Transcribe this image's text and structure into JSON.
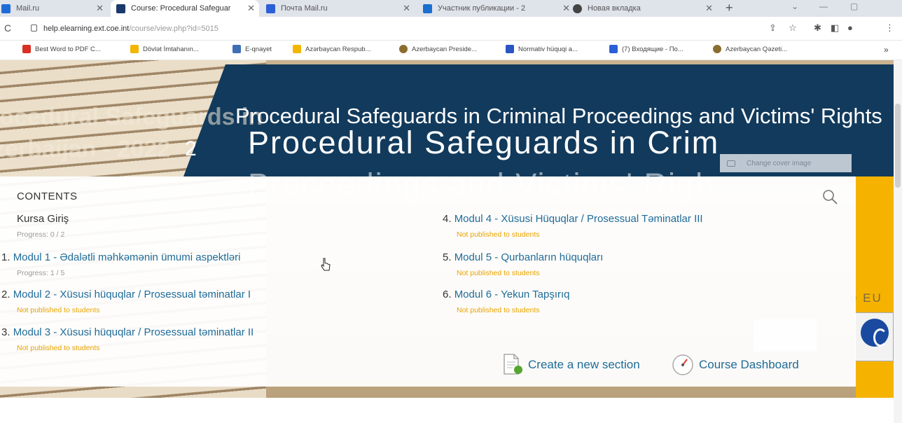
{
  "browser": {
    "tabs": [
      {
        "label": "Mail.ru",
        "color": "#1e6bd8",
        "active": false
      },
      {
        "label": "Course: Procedural Safeguar",
        "color": "#1a3a6c",
        "active": true
      },
      {
        "label": "Почта Mail.ru",
        "color": "#2b5fd8",
        "active": false
      },
      {
        "label": "Участник публикации - 2",
        "color": "#1a6fd0",
        "active": false
      },
      {
        "label": "Новая вкладка",
        "color": "#444444",
        "active": false
      }
    ],
    "url_host": "help.elearning.ext.coe.int",
    "url_path": "/course/view.php?id=5015",
    "bookmarks": [
      {
        "label": "Best Word to PDF C...",
        "color": "#d93025"
      },
      {
        "label": "Dövlət İmtahanın...",
        "color": "#f2b600"
      },
      {
        "label": "E-qnayet",
        "color": "#3f6fb5"
      },
      {
        "label": "Azərbaycan Respub...",
        "color": "#f2b600"
      },
      {
        "label": "Azerbaycan Preside...",
        "color": "#8a6d2f"
      },
      {
        "label": "Normativ hüquqi a...",
        "color": "#2a55c2"
      },
      {
        "label": "(7) Входящие - По...",
        "color": "#2b5fd8"
      },
      {
        "label": "Azerbaycan Qəzeti...",
        "color": "#8a6d2f"
      }
    ]
  },
  "hero": {
    "title": "Procedural Safeguards in Criminal Proceedings and Victims' Rights",
    "year": "2",
    "bg_title_1": "rocedural Safeguards in",
    "bg_title_2": "zerbaijan - 2022",
    "ghost_1": "Procedural Safeguards in Crim",
    "ghost_2": "Proceedings and Victims' Righ",
    "change_cover": "Change cover image",
    "eu": "e EU"
  },
  "contents": {
    "heading": "CONTENTS",
    "left": [
      {
        "num": "",
        "title": "Kursa Giriş",
        "sub": "Progress: 0 / 2",
        "warn": false,
        "link": false
      },
      {
        "num": "1. ",
        "title": "Modul 1 - Ədalətli məhkəmənin ümumi aspektləri",
        "sub": "Progress: 1 / 5",
        "warn": false,
        "link": true
      },
      {
        "num": "2. ",
        "title": "Modul 2 - Xüsusi hüquqlar / Prosessual təminatlar I",
        "sub": "Not published to students",
        "warn": true,
        "link": true
      },
      {
        "num": "3. ",
        "title": "Modul 3 - Xüsusi hüquqlar / Prosessual təminatlar II",
        "sub": "Not published to students",
        "warn": true,
        "link": true
      }
    ],
    "right": [
      {
        "num": "4. ",
        "title": "Modul 4 - Xüsusi Hüquqlar / Prosessual Təminatlar III",
        "sub": "Not published to students",
        "warn": true,
        "link": true
      },
      {
        "num": "5. ",
        "title": "Modul 5 - Qurbanların hüquqları",
        "sub": "Not published to students",
        "warn": true,
        "link": true
      },
      {
        "num": "6. ",
        "title": "Modul 6 - Yekun Tapşırıq",
        "sub": "Not published to students",
        "warn": true,
        "link": true
      }
    ],
    "create_section": "Create a new section",
    "course_dashboard": "Course Dashboard"
  },
  "colors": {
    "navy": "#123a5c",
    "link": "#1f6c98",
    "warning": "#e8a400",
    "gold": "#f5b300"
  }
}
